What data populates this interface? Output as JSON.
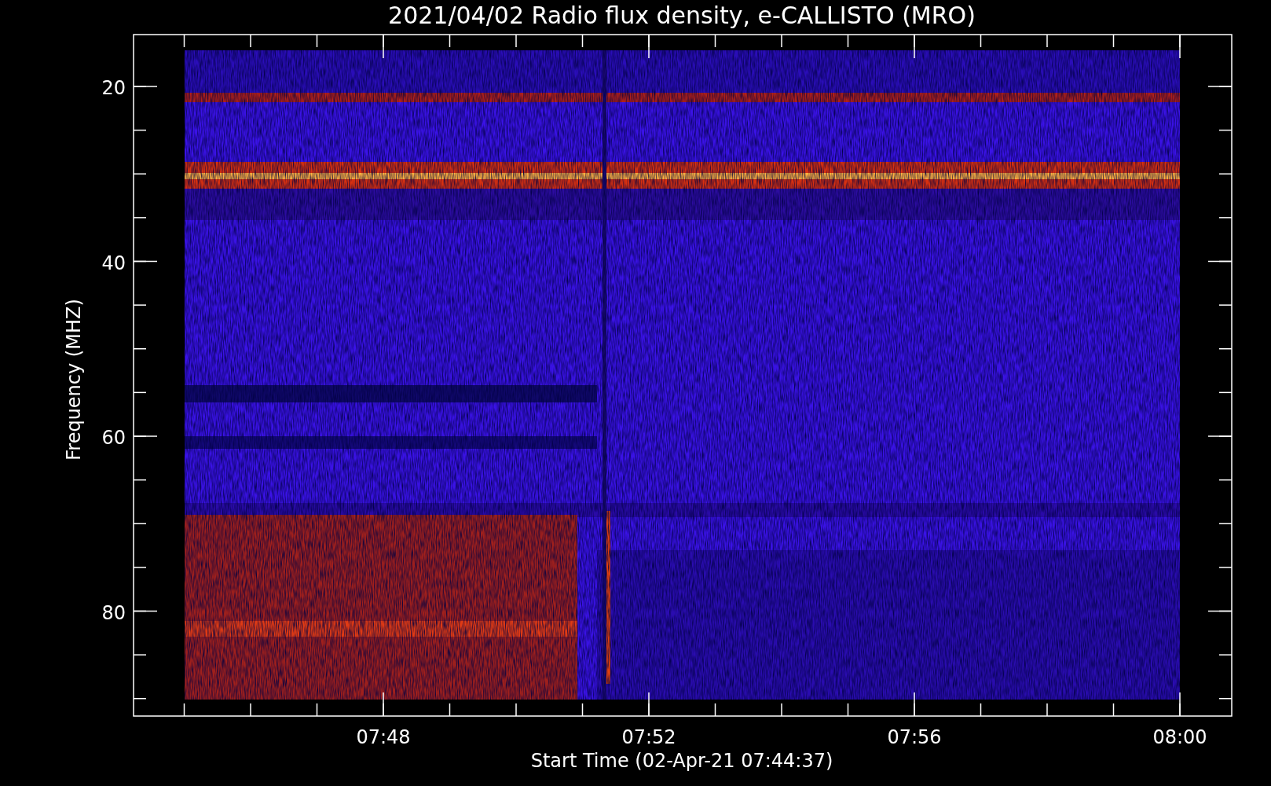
{
  "title": "2021/04/02  Radio flux density, e-CALLISTO (MRO)",
  "y_axis": {
    "label": "Frequency (MHZ)",
    "ticks": [
      "20",
      "40",
      "60",
      "80"
    ]
  },
  "x_axis": {
    "label": "Start Time (02-Apr-21 07:44:37)",
    "ticks": [
      "07:48",
      "07:52",
      "07:56",
      "08:00"
    ]
  }
}
